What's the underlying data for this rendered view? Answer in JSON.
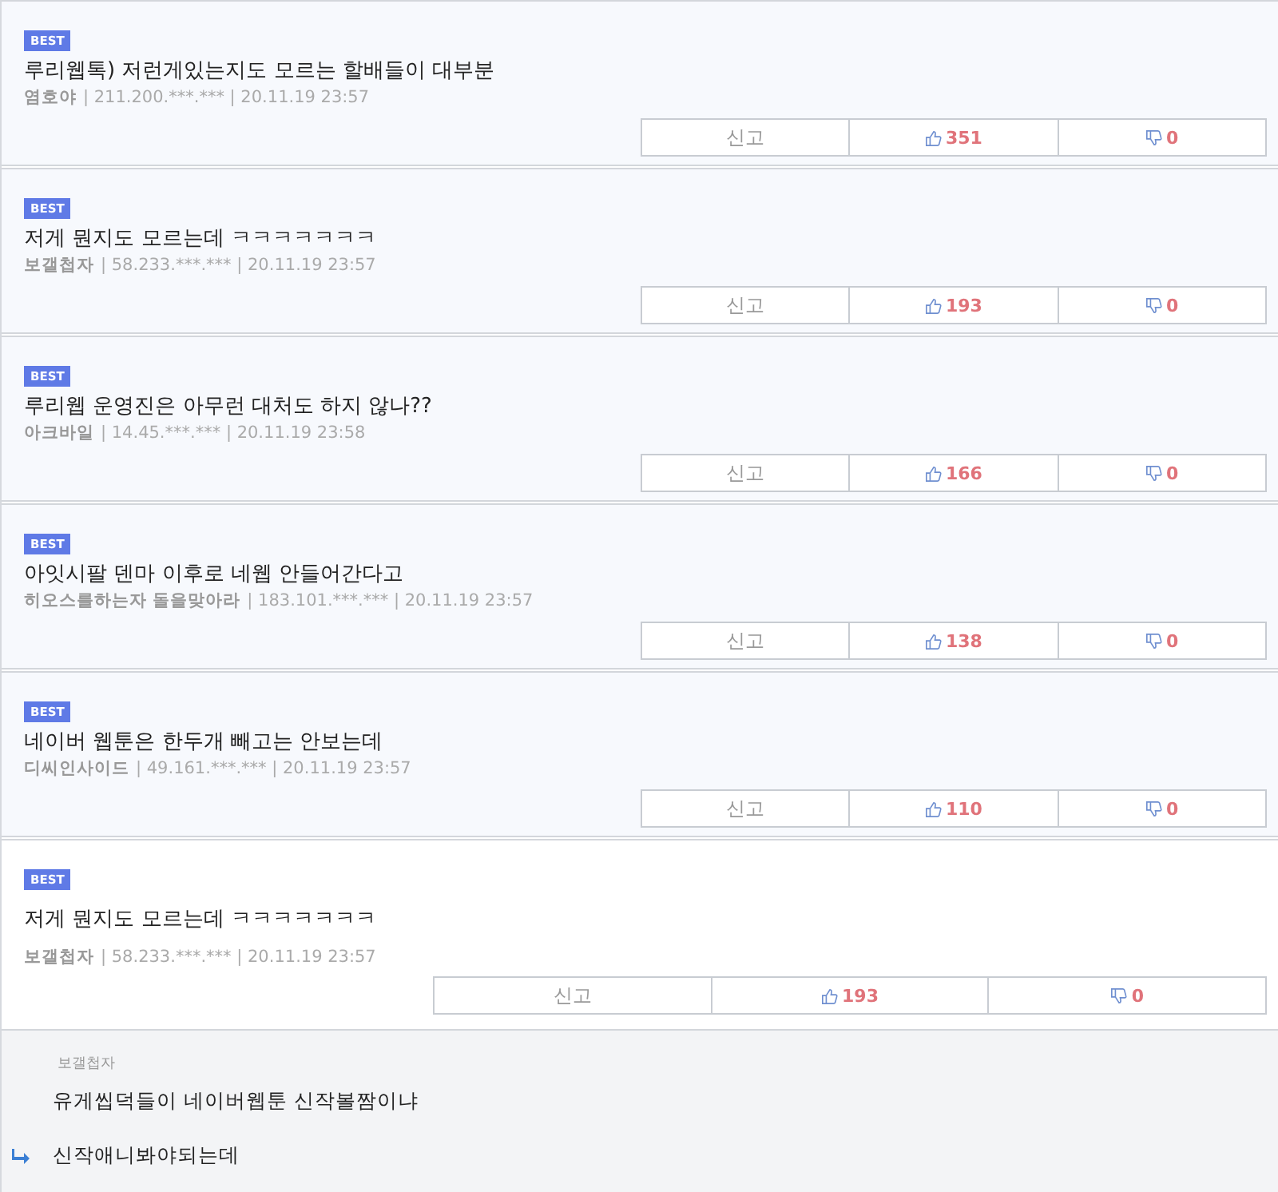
{
  "comments": [
    {
      "badge": "BEST",
      "text": "루리웹톡) 저런게있는지도 모르는 할배들이 대부분",
      "author": "염호야",
      "info": "| 211.200.***.*** | 20.11.19 23:57",
      "report": "신고",
      "likes": "351",
      "dislikes": "0",
      "highlighted": true
    },
    {
      "badge": "BEST",
      "text": "저게 뭔지도 모르는데 ㅋㅋㅋㅋㅋㅋㅋ",
      "author": "보갤첩자",
      "info": "| 58.233.***.*** | 20.11.19 23:57",
      "report": "신고",
      "likes": "193",
      "dislikes": "0",
      "highlighted": true
    },
    {
      "badge": "BEST",
      "text": "루리웹 운영진은 아무런 대처도 하지 않나??",
      "author": "아크바일",
      "info": "| 14.45.***.*** | 20.11.19 23:58",
      "report": "신고",
      "likes": "166",
      "dislikes": "0",
      "highlighted": true
    },
    {
      "badge": "BEST",
      "text": "아잇시팔 덴마 이후로 네웹 안들어간다고",
      "author": "히오스를하는자 돌을맞아라",
      "info": "| 183.101.***.*** | 20.11.19 23:57",
      "report": "신고",
      "likes": "138",
      "dislikes": "0",
      "highlighted": true
    },
    {
      "badge": "BEST",
      "text": "네이버 웹툰은 한두개 빼고는 안보는데",
      "author": "디씨인사이드",
      "info": "| 49.161.***.*** | 20.11.19 23:57",
      "report": "신고",
      "likes": "110",
      "dislikes": "0",
      "highlighted": true
    },
    {
      "badge": "BEST",
      "text": "저게 뭔지도 모르는데 ㅋㅋㅋㅋㅋㅋㅋ",
      "author": "보갤첩자",
      "info": "| 58.233.***.*** | 20.11.19 23:57",
      "report": "신고",
      "likes": "193",
      "dislikes": "0",
      "highlighted": false
    }
  ],
  "reply": {
    "author": "보갤첩자",
    "text": "유게씹덕들이 네이버웹툰 신작볼짬이냐",
    "answer": "신작애니봐야되는데"
  }
}
